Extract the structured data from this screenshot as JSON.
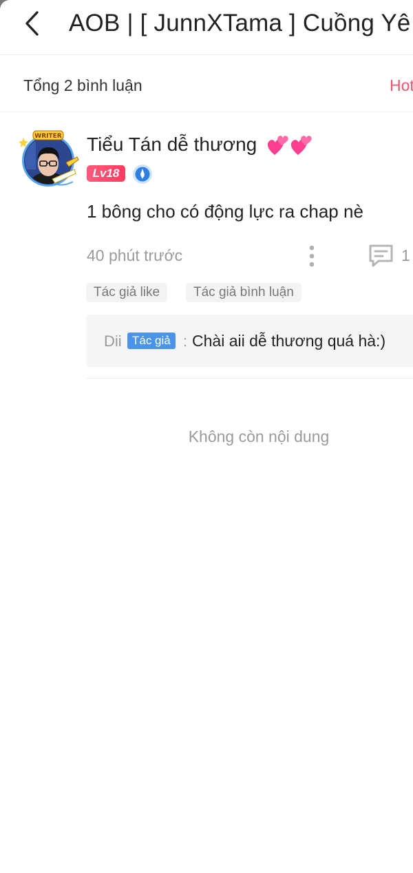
{
  "header": {
    "title": "AOB | [ JunnXTama ] Cuồng Yê",
    "back_icon": "chevron-left-icon"
  },
  "comments_bar": {
    "total_label": "Tổng 2 bình luận",
    "sort_label": "Hot"
  },
  "comment": {
    "username": "Tiểu Tán dễ thương",
    "emoji": "💕💕",
    "avatar_badge": "WRITER",
    "level": "Lv18",
    "body": "1 bông cho có động lực ra chap nè",
    "time": "40 phút trước",
    "reply_count": "1",
    "tags": [
      "Tác giả like",
      "Tác giả bình luận"
    ],
    "reply": {
      "name": "Dii",
      "badge": "Tác giả",
      "separator": ":",
      "text": "Chài aii dễ thương quá hà:)"
    }
  },
  "footer": {
    "end_text": "Không còn nội dung"
  },
  "colors": {
    "accent_pink": "#e8576f",
    "level_badge": "#ff4a6e",
    "author_badge": "#4a93e8"
  }
}
